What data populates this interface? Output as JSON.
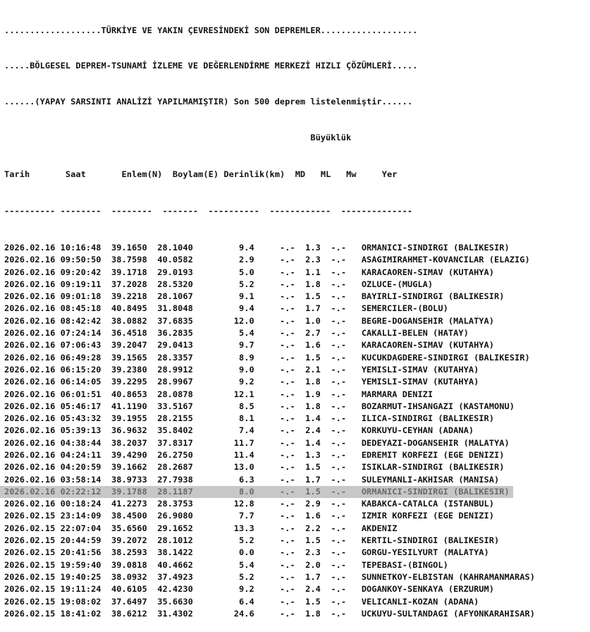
{
  "header": {
    "line1": "...................TÜRKİYE VE YAKIN ÇEVRESİNDEKİ SON DEPREMLER...................",
    "line2": ".....BÖLGESEL DEPREM-TSUNAMİ İZLEME VE DEĞERLENDİRME MERKEZİ HIZLI ÇÖZÜMLERİ.....",
    "line3": "......(YAPAY SARSINTI ANALİZİ YAPILMAMIŞTIR) Son 500 deprem listelenmiştir......"
  },
  "columns": {
    "group": "Büyüklük",
    "tarih": "Tarih",
    "saat": "Saat",
    "enlem": "Enlem(N)",
    "boylam": "Boylam(E)",
    "derinlik": "Derinlik(km)",
    "md": "MD",
    "ml": "ML",
    "mw": "Mw",
    "yer": "Yer"
  },
  "separator": "---------- --------  --------  -------  ----------  ------------  --------------",
  "highlighted_row_index": 20,
  "rows": [
    {
      "date": "2026.02.16",
      "time": "10:16:48",
      "lat": "39.1650",
      "lon": "28.1040",
      "depth": "9.4",
      "md": "-.-",
      "ml": "1.3",
      "mw": "-.-",
      "place": "ORMANICI-SINDIRGI (BALIKESIR)"
    },
    {
      "date": "2026.02.16",
      "time": "09:50:50",
      "lat": "38.7598",
      "lon": "40.0582",
      "depth": "2.9",
      "md": "-.-",
      "ml": "2.3",
      "mw": "-.-",
      "place": "ASAGIMIRAHMET-KOVANCILAR (ELAZIG)"
    },
    {
      "date": "2026.02.16",
      "time": "09:20:42",
      "lat": "39.1718",
      "lon": "29.0193",
      "depth": "5.0",
      "md": "-.-",
      "ml": "1.1",
      "mw": "-.-",
      "place": "KARACAOREN-SIMAV (KUTAHYA)"
    },
    {
      "date": "2026.02.16",
      "time": "09:19:11",
      "lat": "37.2028",
      "lon": "28.5320",
      "depth": "5.2",
      "md": "-.-",
      "ml": "1.8",
      "mw": "-.-",
      "place": "OZLUCE-(MUGLA)"
    },
    {
      "date": "2026.02.16",
      "time": "09:01:18",
      "lat": "39.2218",
      "lon": "28.1067",
      "depth": "9.1",
      "md": "-.-",
      "ml": "1.5",
      "mw": "-.-",
      "place": "BAYIRLI-SINDIRGI (BALIKESIR)"
    },
    {
      "date": "2026.02.16",
      "time": "08:45:18",
      "lat": "40.8495",
      "lon": "31.8048",
      "depth": "9.4",
      "md": "-.-",
      "ml": "1.7",
      "mw": "-.-",
      "place": "SEMERCILER-(BOLU)"
    },
    {
      "date": "2026.02.16",
      "time": "08:42:42",
      "lat": "38.0882",
      "lon": "37.6835",
      "depth": "12.0",
      "md": "-.-",
      "ml": "1.0",
      "mw": "-.-",
      "place": "BEGRE-DOGANSEHIR (MALATYA)"
    },
    {
      "date": "2026.02.16",
      "time": "07:24:14",
      "lat": "36.4518",
      "lon": "36.2835",
      "depth": "5.4",
      "md": "-.-",
      "ml": "2.7",
      "mw": "-.-",
      "place": "CAKALLI-BELEN (HATAY)"
    },
    {
      "date": "2026.02.16",
      "time": "07:06:43",
      "lat": "39.2047",
      "lon": "29.0413",
      "depth": "9.7",
      "md": "-.-",
      "ml": "1.6",
      "mw": "-.-",
      "place": "KARACAOREN-SIMAV (KUTAHYA)"
    },
    {
      "date": "2026.02.16",
      "time": "06:49:28",
      "lat": "39.1565",
      "lon": "28.3357",
      "depth": "8.9",
      "md": "-.-",
      "ml": "1.5",
      "mw": "-.-",
      "place": "KUCUKDAGDERE-SINDIRGI (BALIKESIR)"
    },
    {
      "date": "2026.02.16",
      "time": "06:15:20",
      "lat": "39.2380",
      "lon": "28.9912",
      "depth": "9.0",
      "md": "-.-",
      "ml": "2.1",
      "mw": "-.-",
      "place": "YEMISLI-SIMAV (KUTAHYA)"
    },
    {
      "date": "2026.02.16",
      "time": "06:14:05",
      "lat": "39.2295",
      "lon": "28.9967",
      "depth": "9.2",
      "md": "-.-",
      "ml": "1.8",
      "mw": "-.-",
      "place": "YEMISLI-SIMAV (KUTAHYA)"
    },
    {
      "date": "2026.02.16",
      "time": "06:01:51",
      "lat": "40.8653",
      "lon": "28.0878",
      "depth": "12.1",
      "md": "-.-",
      "ml": "1.9",
      "mw": "-.-",
      "place": "MARMARA DENIZI"
    },
    {
      "date": "2026.02.16",
      "time": "05:46:17",
      "lat": "41.1190",
      "lon": "33.5167",
      "depth": "8.5",
      "md": "-.-",
      "ml": "1.8",
      "mw": "-.-",
      "place": "BOZARMUT-IHSANGAZI (KASTAMONU)"
    },
    {
      "date": "2026.02.16",
      "time": "05:43:32",
      "lat": "39.1955",
      "lon": "28.2155",
      "depth": "8.1",
      "md": "-.-",
      "ml": "1.4",
      "mw": "-.-",
      "place": "ILICA-SINDIRGI (BALIKESIR)"
    },
    {
      "date": "2026.02.16",
      "time": "05:39:13",
      "lat": "36.9632",
      "lon": "35.8402",
      "depth": "7.4",
      "md": "-.-",
      "ml": "2.4",
      "mw": "-.-",
      "place": "KORKUYU-CEYHAN (ADANA)"
    },
    {
      "date": "2026.02.16",
      "time": "04:38:44",
      "lat": "38.2037",
      "lon": "37.8317",
      "depth": "11.7",
      "md": "-.-",
      "ml": "1.4",
      "mw": "-.-",
      "place": "DEDEYAZI-DOGANSEHIR (MALATYA)"
    },
    {
      "date": "2026.02.16",
      "time": "04:24:11",
      "lat": "39.4290",
      "lon": "26.2750",
      "depth": "11.4",
      "md": "-.-",
      "ml": "1.3",
      "mw": "-.-",
      "place": "EDREMIT KORFEZI (EGE DENIZI)"
    },
    {
      "date": "2026.02.16",
      "time": "04:20:59",
      "lat": "39.1662",
      "lon": "28.2687",
      "depth": "13.0",
      "md": "-.-",
      "ml": "1.5",
      "mw": "-.-",
      "place": "ISIKLAR-SINDIRGI (BALIKESIR)"
    },
    {
      "date": "2026.02.16",
      "time": "03:58:14",
      "lat": "38.9733",
      "lon": "27.7938",
      "depth": "6.3",
      "md": "-.-",
      "ml": "1.7",
      "mw": "-.-",
      "place": "SULEYMANLI-AKHISAR (MANISA)"
    },
    {
      "date": "2026.02.16",
      "time": "02:22:12",
      "lat": "39.1788",
      "lon": "28.1187",
      "depth": "8.0",
      "md": "-.-",
      "ml": "1.5",
      "mw": "-.-",
      "place": "ORMANICI-SINDIRGI (BALIKESIR)"
    },
    {
      "date": "2026.02.16",
      "time": "00:18:24",
      "lat": "41.2273",
      "lon": "28.3753",
      "depth": "12.8",
      "md": "-.-",
      "ml": "2.9",
      "mw": "-.-",
      "place": "KABAKCA-CATALCA (ISTANBUL)"
    },
    {
      "date": "2026.02.15",
      "time": "23:14:09",
      "lat": "38.4500",
      "lon": "26.9080",
      "depth": "7.7",
      "md": "-.-",
      "ml": "1.6",
      "mw": "-.-",
      "place": "IZMIR KORFEZI (EGE DENIZI)"
    },
    {
      "date": "2026.02.15",
      "time": "22:07:04",
      "lat": "35.6560",
      "lon": "29.1652",
      "depth": "13.3",
      "md": "-.-",
      "ml": "2.2",
      "mw": "-.-",
      "place": "AKDENIZ"
    },
    {
      "date": "2026.02.15",
      "time": "20:44:59",
      "lat": "39.2072",
      "lon": "28.1012",
      "depth": "5.2",
      "md": "-.-",
      "ml": "1.5",
      "mw": "-.-",
      "place": "KERTIL-SINDIRGI (BALIKESIR)"
    },
    {
      "date": "2026.02.15",
      "time": "20:41:56",
      "lat": "38.2593",
      "lon": "38.1422",
      "depth": "0.0",
      "md": "-.-",
      "ml": "2.3",
      "mw": "-.-",
      "place": "GORGU-YESILYURT (MALATYA)"
    },
    {
      "date": "2026.02.15",
      "time": "19:59:40",
      "lat": "39.0818",
      "lon": "40.4662",
      "depth": "5.4",
      "md": "-.-",
      "ml": "2.0",
      "mw": "-.-",
      "place": "TEPEBASI-(BINGOL)"
    },
    {
      "date": "2026.02.15",
      "time": "19:40:25",
      "lat": "38.0932",
      "lon": "37.4923",
      "depth": "5.2",
      "md": "-.-",
      "ml": "1.7",
      "mw": "-.-",
      "place": "SUNNETKOY-ELBISTAN (KAHRAMANMARAS)"
    },
    {
      "date": "2026.02.15",
      "time": "19:11:24",
      "lat": "40.6105",
      "lon": "42.4230",
      "depth": "9.2",
      "md": "-.-",
      "ml": "2.4",
      "mw": "-.-",
      "place": "DOGANKOY-SENKAYA (ERZURUM)"
    },
    {
      "date": "2026.02.15",
      "time": "19:08:02",
      "lat": "37.6497",
      "lon": "35.6630",
      "depth": "6.4",
      "md": "-.-",
      "ml": "1.5",
      "mw": "-.-",
      "place": "VELICANLI-KOZAN (ADANA)"
    },
    {
      "date": "2026.02.15",
      "time": "18:41:02",
      "lat": "38.6212",
      "lon": "31.4302",
      "depth": "24.6",
      "md": "-.-",
      "ml": "1.8",
      "mw": "-.-",
      "place": "UCKUYU-SULTANDAGI (AFYONKARAHISAR)"
    }
  ]
}
